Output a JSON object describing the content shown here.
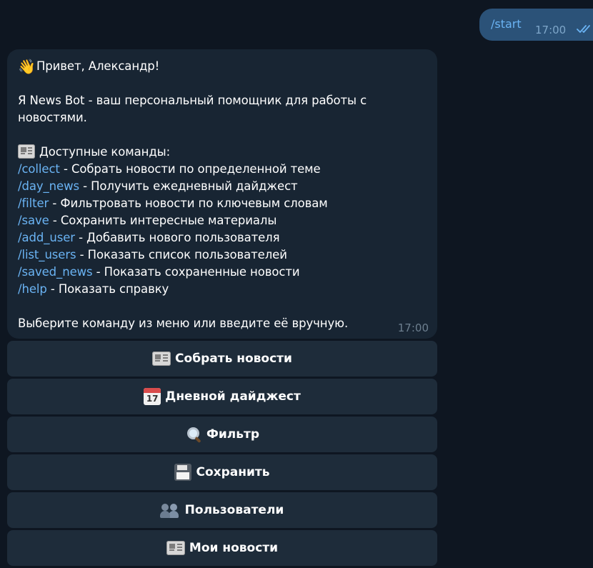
{
  "outgoing": {
    "text": "/start",
    "time": "17:00",
    "status": "read-double-check"
  },
  "incoming": {
    "greeting_emoji": "👋",
    "greeting": "Привет, Александр!",
    "intro_line1": "Я News Bot - ваш персональный помощник для работы с",
    "intro_line2": "новостями.",
    "commands_header_icon": "newspaper-icon",
    "commands_header": "Доступные команды:",
    "commands": [
      {
        "cmd": "/collect",
        "desc": " - Собрать новости по определенной теме"
      },
      {
        "cmd": "/day_news",
        "desc": " - Получить ежедневный дайджест"
      },
      {
        "cmd": "/filter",
        "desc": " - Фильтровать новости по ключевым словам"
      },
      {
        "cmd": "/save",
        "desc": " - Сохранить интересные материалы"
      },
      {
        "cmd": "/add_user",
        "desc": " - Добавить нового пользователя"
      },
      {
        "cmd": "/list_users",
        "desc": " - Показать список пользователей"
      },
      {
        "cmd": "/saved_news",
        "desc": " - Показать сохраненные новости"
      },
      {
        "cmd": "/help",
        "desc": " - Показать справку"
      }
    ],
    "footer": "Выберите команду из меню или введите её вручную.",
    "time": "17:00"
  },
  "keyboard": [
    {
      "label": "Собрать новости",
      "icon": "newspaper-icon"
    },
    {
      "label": "Дневной дайджест",
      "icon": "calendar-icon",
      "icon_text": "17"
    },
    {
      "label": "Фильтр",
      "icon": "magnifier-icon"
    },
    {
      "label": "Сохранить",
      "icon": "floppy-disk-icon"
    },
    {
      "label": "Пользователи",
      "icon": "users-icon"
    },
    {
      "label": "Мои новости",
      "icon": "newspaper-icon"
    }
  ],
  "colors": {
    "background": "#0e1621",
    "incoming_bubble": "#182533",
    "outgoing_bubble": "#2b5278",
    "link": "#6ab3f3",
    "keyboard_button": "#1e2c3a"
  }
}
